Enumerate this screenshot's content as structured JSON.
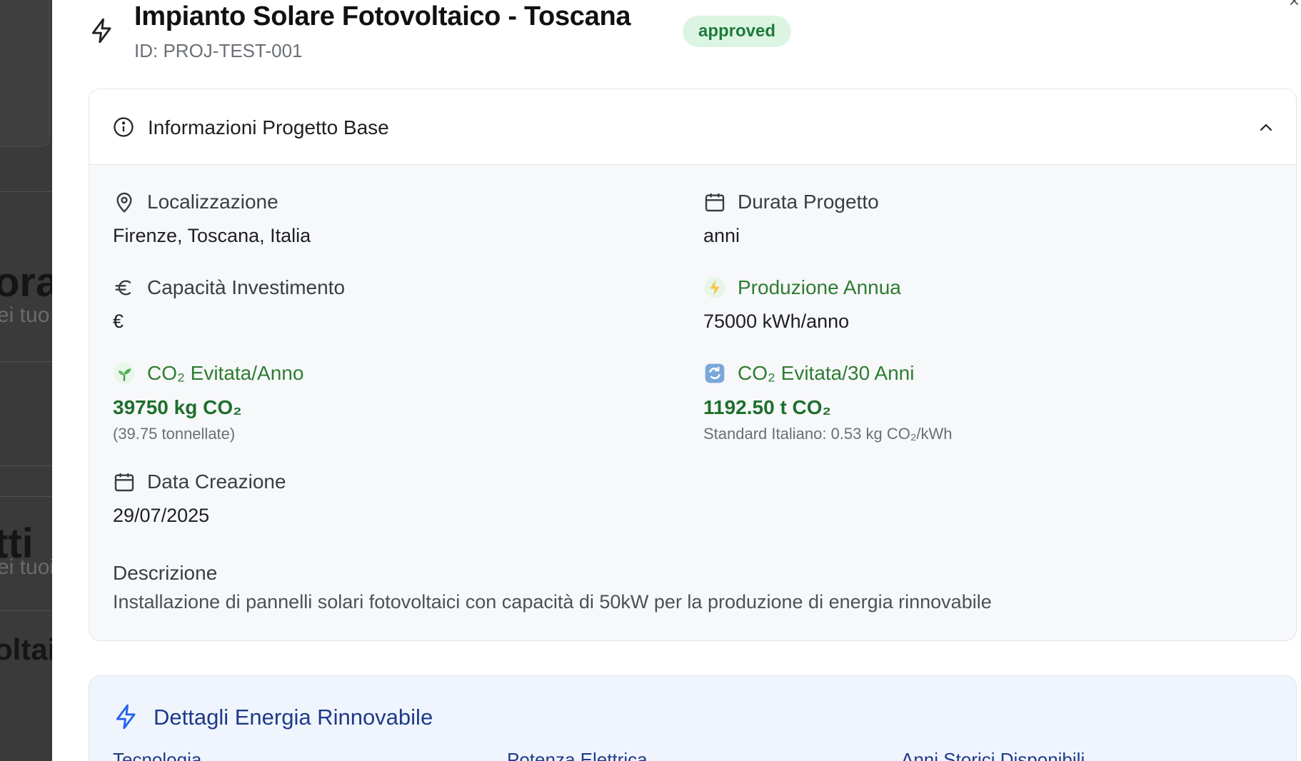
{
  "background": {
    "fragments": [
      {
        "text": "orag",
        "kind": "title"
      },
      {
        "text": "ei tuo",
        "kind": "sub"
      },
      {
        "text": "tti",
        "kind": "title"
      },
      {
        "text": "ei tuoi",
        "kind": "sub"
      },
      {
        "text": "oltai",
        "kind": "title"
      }
    ]
  },
  "modal": {
    "close_label": "×",
    "title": "Impianto Solare Fotovoltaico - Toscana",
    "status_badge": "approved",
    "project_id": "ID: PROJ-TEST-001"
  },
  "base_info": {
    "section_title": "Informazioni Progetto Base",
    "location": {
      "label": "Localizzazione",
      "value": "Firenze, Toscana, Italia"
    },
    "duration": {
      "label": "Durata Progetto",
      "value": "anni"
    },
    "investment": {
      "label": "Capacità Investimento",
      "value": "€"
    },
    "production": {
      "label": "Produzione Annua",
      "value": "75000 kWh/anno"
    },
    "co2_year": {
      "label": "CO₂ Evitata/Anno",
      "value": "39750 kg CO₂",
      "note": "(39.75 tonnellate)"
    },
    "co2_30": {
      "label": "CO₂ Evitata/30 Anni",
      "value": "1192.50 t CO₂",
      "note": "Standard Italiano: 0.53 kg CO₂/kWh"
    },
    "created": {
      "label": "Data Creazione",
      "value": "29/07/2025"
    },
    "description": {
      "label": "Descrizione",
      "value": "Installazione di pannelli solari fotovoltaici con capacità di 50kW per la produzione di energia rinnovabile"
    }
  },
  "energy": {
    "section_title": "Dettagli Energia Rinnovabile",
    "sub_labels": [
      "Tecnologia",
      "Potenza Elettrica",
      "Anni Storici Disponibili"
    ]
  },
  "colors": {
    "accent_green": "#2e7d32",
    "badge_bg": "#dcf5e3",
    "energy_blue": "#1e3a8a"
  }
}
